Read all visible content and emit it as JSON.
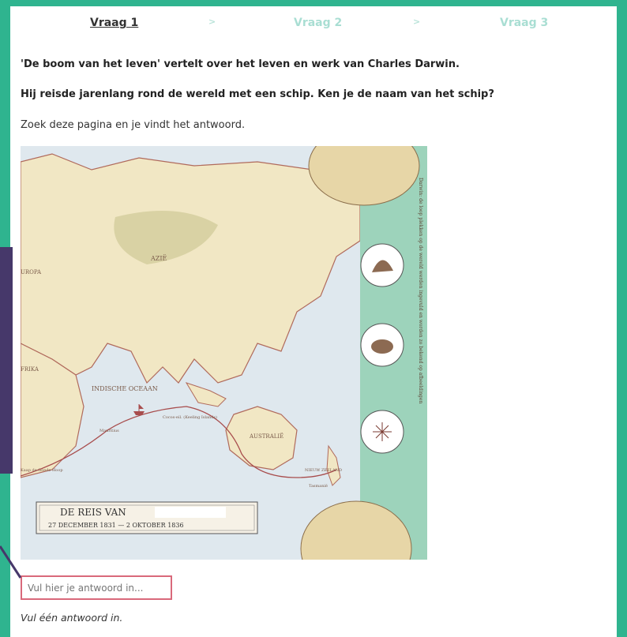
{
  "steps": [
    {
      "label": "Vraag 1",
      "active": true
    },
    {
      "label": "Vraag 2",
      "active": false
    },
    {
      "label": "Vraag 3",
      "active": false
    }
  ],
  "step_separator": ">",
  "question": {
    "line1": "'De boom van het leven' vertelt over het leven en werk van Charles Darwin.",
    "line2": "Hij reisde jarenlang rond de wereld met een schip. Ken je de naam van het schip?",
    "intro": "Zoek deze pagina en je vindt het antwoord."
  },
  "map": {
    "title": "DE REIS VAN",
    "dates": "27 DECEMBER 1831 — 2 OKTOBER 1836",
    "labels": {
      "azie": "AZIË",
      "europa": "UROPA",
      "afrika": "FRIKA",
      "ocean": "INDISCHE OCEAAN",
      "australie": "AUSTRALIË",
      "mauritius": "Mauritius",
      "cocos": "Cocos-eil. (Keeling Islands)",
      "kaap": "Kaap de Goede Hoop",
      "nz": "NIEUW ZEELAND",
      "tasmanie": "Tasmanië"
    },
    "border_text": "Darwin: de loop plekken op de wereld werden ingevuld en worden zo bekend op afbeeldingen"
  },
  "answer": {
    "placeholder": "Vul hier je antwoord in...",
    "hint": "Vul één antwoord in."
  },
  "colors": {
    "background": "#2fb48f",
    "active_step": "#333333",
    "inactive_step": "#a9ded3",
    "input_border": "#d9697b",
    "overlay": "#46386a"
  }
}
